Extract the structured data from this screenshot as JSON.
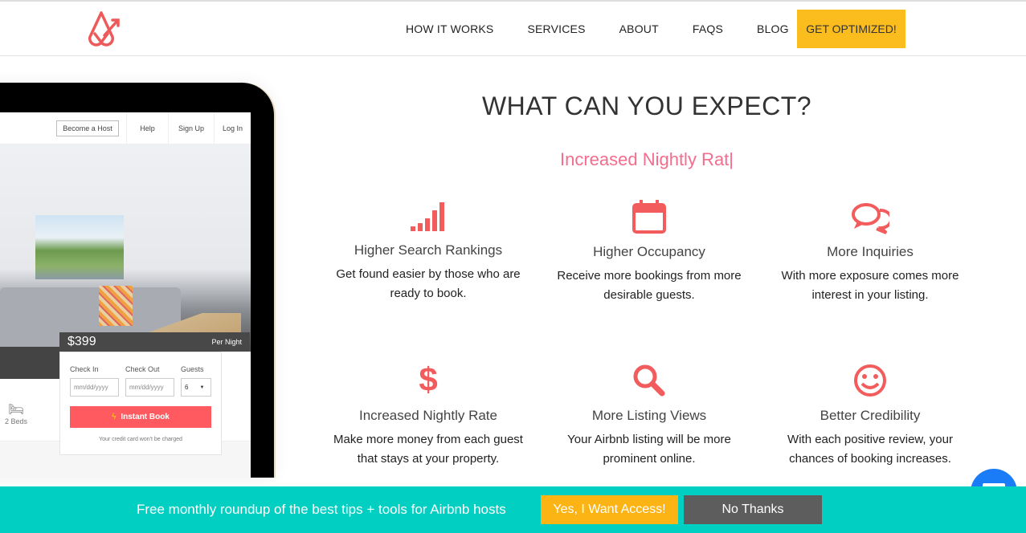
{
  "nav": {
    "items": [
      "HOW IT WORKS",
      "SERVICES",
      "ABOUT",
      "FAQS",
      "BLOG"
    ],
    "cta": "GET OPTIMIZED!"
  },
  "mock": {
    "become_host": "Become a Host",
    "help": "Help",
    "sign_up": "Sign Up",
    "log_in": "Log In",
    "price": "$399",
    "per_night": "Per Night",
    "check_in": "Check In",
    "check_out": "Check Out",
    "guests": "Guests",
    "date_placeholder": "mm/dd/yyyy",
    "guests_value": "6",
    "instant_book": "Instant Book",
    "note": "Your credit card won't be charged",
    "beds": "2 Beds"
  },
  "main": {
    "title": "WHAT CAN YOU EXPECT?",
    "typed": "Increased Nightly Rat|",
    "features": [
      {
        "icon": "signal-bars-icon",
        "title": "Higher Search Rankings",
        "desc": "Get found easier by those who are ready to book."
      },
      {
        "icon": "calendar-icon",
        "title": "Higher Occupancy",
        "desc": "Receive more bookings from more desirable guests."
      },
      {
        "icon": "chat-bubbles-icon",
        "title": "More Inquiries",
        "desc": "With more exposure comes more interest in your listing."
      },
      {
        "icon": "dollar-icon",
        "title": "Increased Nightly Rate",
        "desc": "Make more money from each guest that stays at your property."
      },
      {
        "icon": "search-icon",
        "title": "More Listing Views",
        "desc": "Your Airbnb listing will be more prominent online."
      },
      {
        "icon": "smiley-icon",
        "title": "Better Credibility",
        "desc": "With each positive review, your chances of booking increases."
      }
    ]
  },
  "banner": {
    "text": "Free monthly roundup of the best tips + tools for Airbnb hosts",
    "yes": "Yes, I Want Access!",
    "no": "No Thanks"
  },
  "colors": {
    "accent": "#ff5a5f",
    "cta": "#fbbd1e",
    "banner": "#00cfc1",
    "typed": "#f36d8c"
  }
}
